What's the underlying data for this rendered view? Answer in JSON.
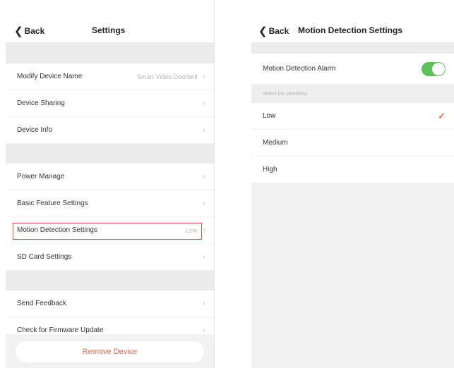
{
  "left": {
    "back_label": "Back",
    "title": "Settings",
    "rows": [
      {
        "label": "Modify Device Name",
        "value": "Smart Video Doorbell"
      },
      {
        "label": "Device Sharing"
      },
      {
        "label": "Device Info"
      },
      {
        "label": "Power Manage"
      },
      {
        "label": "Basic Feature Settings"
      },
      {
        "label": "Motion Detection Settings",
        "value": "Low"
      },
      {
        "label": "SD Card Settings"
      },
      {
        "label": "Send Feedback"
      },
      {
        "label": "Check for Firmware Update"
      }
    ],
    "remove_label": "Remove Device"
  },
  "right": {
    "back_label": "Back",
    "title": "Motion Detection Settings",
    "alarm_label": "Motion Detection Alarm",
    "alarm_on": true,
    "sensitivity_hint": "Select the sensitivity",
    "options": [
      "Low",
      "Medium",
      "High"
    ],
    "selected": "Low"
  },
  "colors": {
    "toggle_on": "#5cc15a",
    "check": "#e8704f",
    "highlight": "#d9534f",
    "remove": "#e06a4f"
  },
  "icons": {
    "back": "chevron-left-icon",
    "row": "chevron-right-icon",
    "selected": "checkmark-icon"
  }
}
